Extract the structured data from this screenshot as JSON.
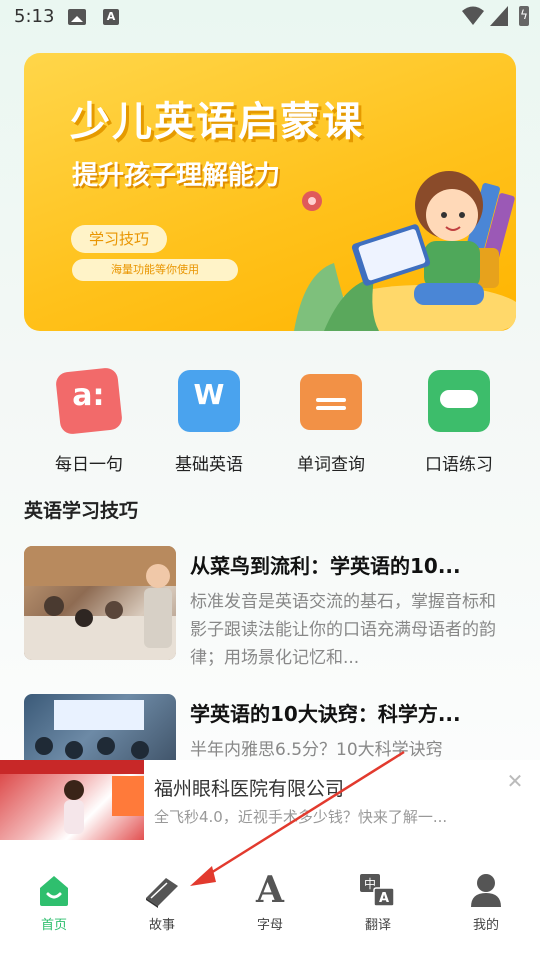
{
  "status_bar": {
    "time": "5:13",
    "icons": [
      "gallery-icon",
      "a-icon",
      "wifi-icon",
      "signal-icon",
      "battery-charging-icon"
    ]
  },
  "banner": {
    "title": "少儿英语启蒙课",
    "subtitle": "提升孩子理解能力",
    "pill_label": "学习技巧",
    "pill_sub": "海量功能等你使用"
  },
  "quick_actions": [
    {
      "label": "每日一句",
      "icon": "daily-sentence-icon",
      "color": "#f26a6a"
    },
    {
      "label": "基础英语",
      "icon": "basic-english-icon",
      "color": "#4aa3ee"
    },
    {
      "label": "单词查询",
      "icon": "word-lookup-icon",
      "color": "#f29146"
    },
    {
      "label": "口语练习",
      "icon": "speaking-practice-icon",
      "color": "#3dbd6b"
    }
  ],
  "section_title": "英语学习技巧",
  "articles": [
    {
      "title": "从菜鸟到流利：学英语的10...",
      "desc": "标准发音是英语交流的基石，掌握音标和影子跟读法能让你的口语充满母语者的韵律；用场景化记忆和..."
    },
    {
      "title": "学英语的10大诀窍：科学方...",
      "desc": "半年内雅思6.5分？10大科学诀窍"
    }
  ],
  "ad": {
    "title": "福州眼科医院有限公司",
    "desc": "全飞秒4.0，近视手术多少钱？快来了解一..."
  },
  "bottom_nav": [
    {
      "label": "首页",
      "icon": "home-icon",
      "active": true
    },
    {
      "label": "故事",
      "icon": "book-icon",
      "active": false
    },
    {
      "label": "字母",
      "icon": "letter-a-icon",
      "active": false
    },
    {
      "label": "翻译",
      "icon": "translate-icon",
      "active": false
    },
    {
      "label": "我的",
      "icon": "profile-icon",
      "active": false
    }
  ],
  "colors": {
    "accent": "#2fbf6e",
    "banner": "#ffc21c",
    "annotation": "#e23a2e"
  }
}
